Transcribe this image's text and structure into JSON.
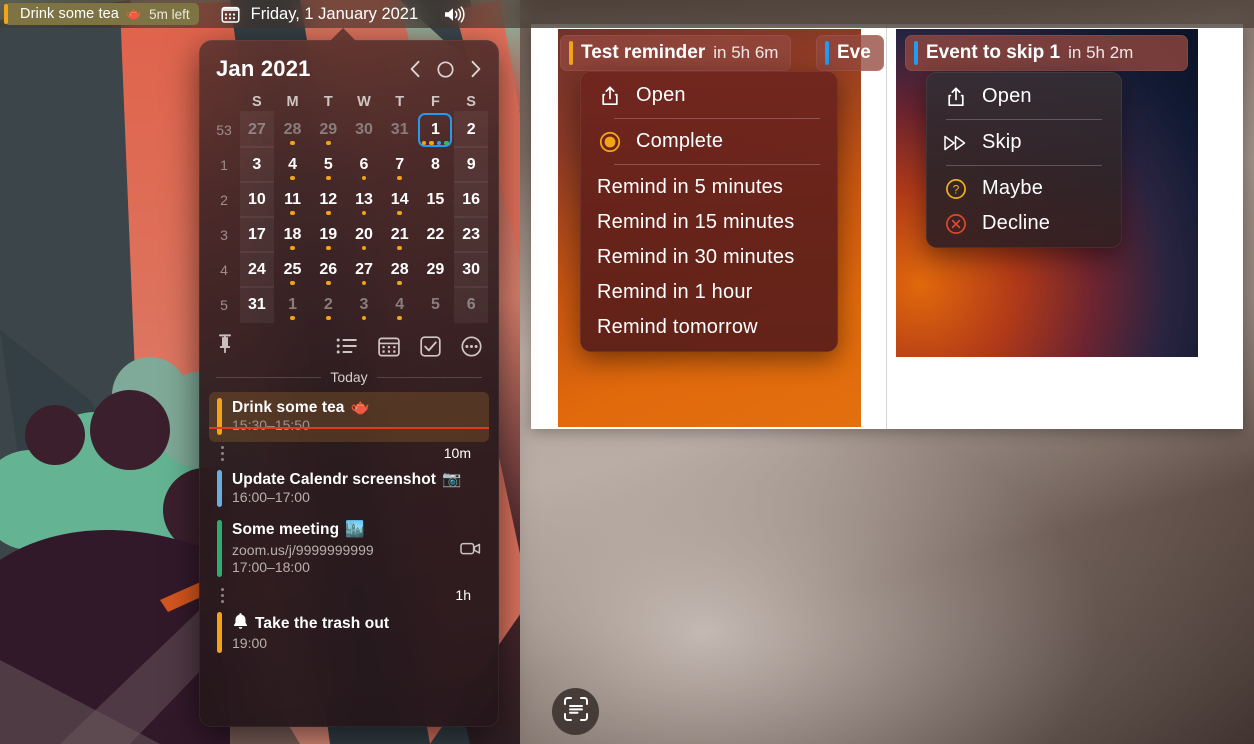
{
  "menubar": {
    "event": {
      "title": "Drink some tea",
      "emoji": "🫖",
      "time_left": "5m left",
      "bar_color": "#f2a417",
      "bg_color": "#7e7443"
    },
    "calendar_icon": "calendar-icon",
    "date": "Friday, 1 January 2021",
    "speaker_icon": "volume-icon"
  },
  "popover": {
    "month_label": "Jan 2021",
    "nav": {
      "prev": "chevron-left-icon",
      "today": "circle-icon",
      "next": "chevron-right-icon"
    },
    "weekday_headers": [
      "S",
      "M",
      "T",
      "W",
      "T",
      "F",
      "S"
    ],
    "week_numbers": [
      "53",
      "1",
      "2",
      "3",
      "4",
      "5"
    ],
    "weeks": [
      [
        {
          "day": "27",
          "dim": true,
          "dots": []
        },
        {
          "day": "28",
          "dim": true,
          "dots": [
            "#f2a417"
          ]
        },
        {
          "day": "29",
          "dim": true,
          "dots": [
            "#f2a417"
          ]
        },
        {
          "day": "30",
          "dim": true,
          "dots": []
        },
        {
          "day": "31",
          "dim": true,
          "dots": []
        },
        {
          "day": "1",
          "dim": false,
          "today": true,
          "dots": [
            "#f2a417",
            "#f2a417",
            "#3b9ae1",
            "#35b66f"
          ]
        },
        {
          "day": "2",
          "dim": false,
          "dots": []
        }
      ],
      [
        {
          "day": "3",
          "dim": false,
          "dots": []
        },
        {
          "day": "4",
          "dim": false,
          "dots": [
            "#f2a417"
          ]
        },
        {
          "day": "5",
          "dim": false,
          "dots": [
            "#f2a417"
          ]
        },
        {
          "day": "6",
          "dim": false,
          "dots": [
            "#f2a417"
          ]
        },
        {
          "day": "7",
          "dim": false,
          "dots": [
            "#f2a417"
          ]
        },
        {
          "day": "8",
          "dim": false,
          "dots": []
        },
        {
          "day": "9",
          "dim": false,
          "dots": []
        }
      ],
      [
        {
          "day": "10",
          "dim": false,
          "dots": []
        },
        {
          "day": "11",
          "dim": false,
          "dots": [
            "#f2a417"
          ]
        },
        {
          "day": "12",
          "dim": false,
          "dots": [
            "#f2a417"
          ]
        },
        {
          "day": "13",
          "dim": false,
          "dots": [
            "#f2a417"
          ]
        },
        {
          "day": "14",
          "dim": false,
          "dots": [
            "#f2a417"
          ]
        },
        {
          "day": "15",
          "dim": false,
          "dots": []
        },
        {
          "day": "16",
          "dim": false,
          "dots": []
        }
      ],
      [
        {
          "day": "17",
          "dim": false,
          "dots": []
        },
        {
          "day": "18",
          "dim": false,
          "dots": [
            "#f2a417"
          ]
        },
        {
          "day": "19",
          "dim": false,
          "dots": [
            "#f2a417"
          ]
        },
        {
          "day": "20",
          "dim": false,
          "dots": [
            "#f2a417"
          ]
        },
        {
          "day": "21",
          "dim": false,
          "dots": [
            "#f2a417"
          ]
        },
        {
          "day": "22",
          "dim": false,
          "dots": []
        },
        {
          "day": "23",
          "dim": false,
          "dots": []
        }
      ],
      [
        {
          "day": "24",
          "dim": false,
          "dots": []
        },
        {
          "day": "25",
          "dim": false,
          "dots": [
            "#f2a417"
          ]
        },
        {
          "day": "26",
          "dim": false,
          "dots": [
            "#f2a417"
          ]
        },
        {
          "day": "27",
          "dim": false,
          "dots": [
            "#f2a417"
          ]
        },
        {
          "day": "28",
          "dim": false,
          "dots": [
            "#f2a417"
          ]
        },
        {
          "day": "29",
          "dim": false,
          "dots": []
        },
        {
          "day": "30",
          "dim": false,
          "dots": []
        }
      ],
      [
        {
          "day": "31",
          "dim": false,
          "dots": []
        },
        {
          "day": "1",
          "dim": true,
          "dots": [
            "#f2a417"
          ]
        },
        {
          "day": "2",
          "dim": true,
          "dots": [
            "#f2a417"
          ]
        },
        {
          "day": "3",
          "dim": true,
          "dots": [
            "#f2a417"
          ]
        },
        {
          "day": "4",
          "dim": true,
          "dots": [
            "#f2a417"
          ]
        },
        {
          "day": "5",
          "dim": true,
          "dots": []
        },
        {
          "day": "6",
          "dim": true,
          "dots": []
        }
      ]
    ],
    "toolbar": {
      "pin": "pin-icon",
      "reminders": "list-icon",
      "calendars": "calendar-icon",
      "tasks": "checkbox-icon",
      "more": "ellipsis-circle-icon"
    },
    "today_divider_label": "Today",
    "events": [
      {
        "kind": "event",
        "title": "Drink some tea",
        "emoji": "🫖",
        "time": "15:30–15:50",
        "bar_color": "#f2a417",
        "current": true,
        "past_time": true
      },
      {
        "kind": "gap",
        "duration": "10m"
      },
      {
        "kind": "event",
        "title": "Update Calendr screenshot",
        "emoji": "📷",
        "time": "16:00–17:00",
        "bar_color": "#6aaee0"
      },
      {
        "kind": "event",
        "title": "Some meeting",
        "emoji": "🏙️",
        "link": "zoom.us/j/9999999999",
        "link_icon": "video-camera-icon",
        "time": "17:00–18:00",
        "bar_color": "#2fad6e"
      },
      {
        "kind": "gap",
        "duration": "1h"
      },
      {
        "kind": "reminder",
        "title": "Take the trash out",
        "icon": "bell-icon",
        "time": "19:00",
        "bar_color": "#f2a417"
      }
    ]
  },
  "panels": {
    "left": {
      "pill": {
        "bar_color": "#f2a417",
        "title": "Test reminder",
        "subtitle": "in 5h 6m"
      },
      "pill_secondary": {
        "bar_color": "#2699f0",
        "title": "Eve"
      },
      "menu_items": [
        {
          "icon": "share-up-icon",
          "label": "Open",
          "type": "icon"
        },
        {
          "type": "separator"
        },
        {
          "icon": "complete-target-icon",
          "label": "Complete",
          "type": "icon"
        },
        {
          "type": "separator"
        },
        {
          "label": "Remind in 5 minutes",
          "type": "plain"
        },
        {
          "label": "Remind in 15 minutes",
          "type": "plain"
        },
        {
          "label": "Remind in 30 minutes",
          "type": "plain"
        },
        {
          "label": "Remind in 1 hour",
          "type": "plain"
        },
        {
          "label": "Remind tomorrow",
          "type": "plain"
        }
      ]
    },
    "right": {
      "pill": {
        "bar_color": "#2699f0",
        "title": "Event to skip 1",
        "subtitle": "in 5h 2m"
      },
      "menu_items": [
        {
          "icon": "share-up-icon",
          "label": "Open",
          "type": "icon"
        },
        {
          "type": "separator"
        },
        {
          "icon": "skip-forward-icon",
          "label": "Skip",
          "type": "icon"
        },
        {
          "type": "separator"
        },
        {
          "icon": "question-circle-icon",
          "label": "Maybe",
          "type": "icon",
          "icon_color": "#f0b21c"
        },
        {
          "icon": "decline-circle-icon",
          "label": "Decline",
          "type": "icon",
          "icon_color": "#e0472c"
        }
      ]
    }
  },
  "scan_button": {
    "icon": "live-text-scan-icon"
  },
  "colors": {
    "accent_blue": "#2699f0",
    "accent_orange": "#f2a417",
    "accent_green": "#2fad6e",
    "now_line_red": "#e03a21"
  }
}
